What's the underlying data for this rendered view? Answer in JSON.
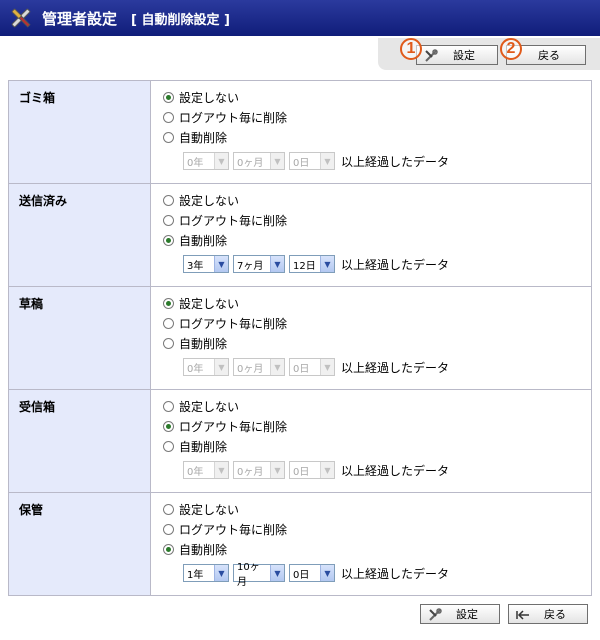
{
  "title": {
    "main": "管理者設定",
    "sub": "[ 自動削除設定 ]"
  },
  "toolbar": {
    "badge1": "1",
    "badge2": "2",
    "save_label": "設定",
    "back_label": "戻る"
  },
  "options": {
    "none": "設定しない",
    "logout": "ログアウト毎に削除",
    "auto": "自動削除",
    "suffix": "以上経過したデータ"
  },
  "folders": [
    {
      "name": "ゴミ箱",
      "selected": "none",
      "year": "0年",
      "month": "0ヶ月",
      "day": "0日",
      "enabled": false
    },
    {
      "name": "送信済み",
      "selected": "auto",
      "year": "3年",
      "month": "7ヶ月",
      "day": "12日",
      "enabled": true
    },
    {
      "name": "草稿",
      "selected": "none",
      "year": "0年",
      "month": "0ヶ月",
      "day": "0日",
      "enabled": false
    },
    {
      "name": "受信箱",
      "selected": "logout",
      "year": "0年",
      "month": "0ヶ月",
      "day": "0日",
      "enabled": false
    },
    {
      "name": "保管",
      "selected": "auto",
      "year": "1年",
      "month": "10ヶ月",
      "day": "0日",
      "enabled": true
    }
  ],
  "colors": {
    "title_bg": "#1a2a8c",
    "label_bg": "#e5eafb",
    "badge": "#e05a1a",
    "radio_dot": "#2b7a2b"
  },
  "icons": {
    "title": "tools-icon",
    "save": "tools-icon",
    "back": "back-arrow-icon"
  }
}
